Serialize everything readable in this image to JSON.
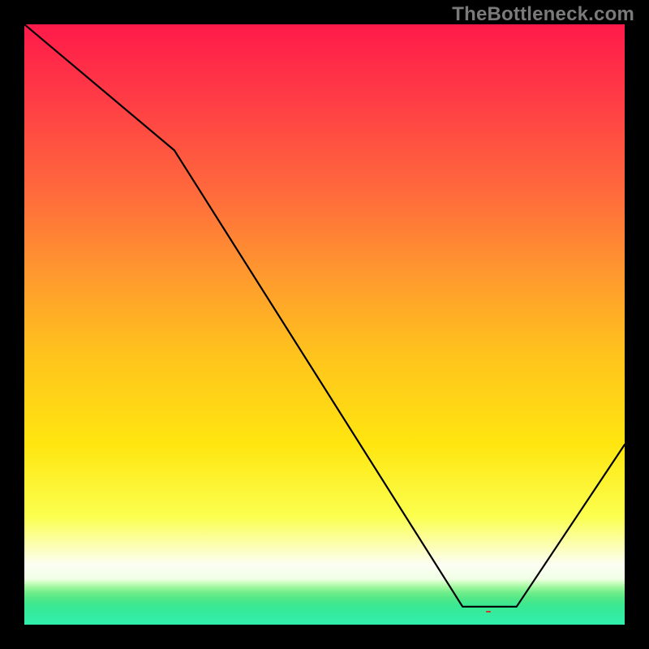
{
  "watermark": "TheBottleneck.com",
  "chart_data": {
    "type": "line",
    "x": [
      0.0,
      0.25,
      0.73,
      0.82,
      1.0
    ],
    "values": [
      0.0,
      0.21,
      0.97,
      0.97,
      0.7
    ],
    "title": "",
    "xlabel": "",
    "ylabel": "",
    "ylim": [
      0,
      1
    ],
    "xlim": [
      0,
      1
    ],
    "note": "Curve drawn over a vertical color gradient (red→yellow→green). Apparent flat segment near x≈0.73–0.82 at y≈0.97 corresponds to the 'best match' zone.",
    "marker_label": "",
    "marker_center_x": 0.773,
    "marker_y": 0.97
  },
  "styling": {
    "frame_color": "#000000",
    "line_color": "#000000",
    "watermark_color": "#7a7a7a",
    "marker_bg": "#d7322e",
    "marker_fg": "#ffb4b4"
  }
}
